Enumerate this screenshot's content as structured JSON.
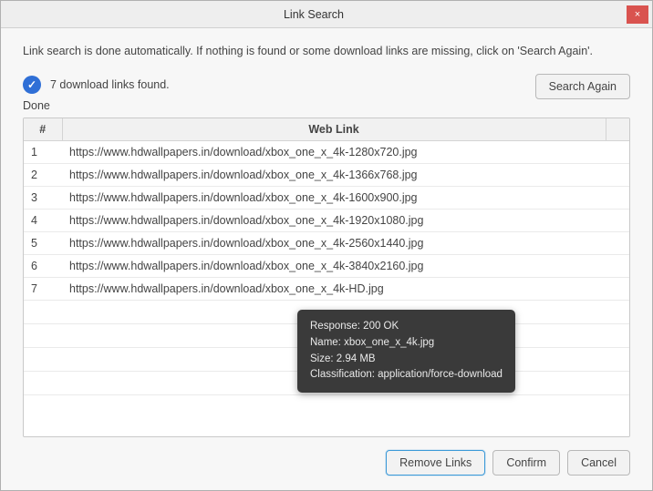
{
  "window": {
    "title": "Link Search"
  },
  "intro": "Link search is done automatically. If nothing is found or some download links are missing, click on 'Search Again'.",
  "status": {
    "found_text": "7 download links found.",
    "done_label": "Done"
  },
  "buttons": {
    "search_again": "Search Again",
    "remove_links": "Remove Links",
    "confirm": "Confirm",
    "cancel": "Cancel",
    "close": "×"
  },
  "table": {
    "headers": {
      "num": "#",
      "link": "Web Link"
    },
    "rows": [
      {
        "num": "1",
        "link": "https://www.hdwallpapers.in/download/xbox_one_x_4k-1280x720.jpg"
      },
      {
        "num": "2",
        "link": "https://www.hdwallpapers.in/download/xbox_one_x_4k-1366x768.jpg"
      },
      {
        "num": "3",
        "link": "https://www.hdwallpapers.in/download/xbox_one_x_4k-1600x900.jpg"
      },
      {
        "num": "4",
        "link": "https://www.hdwallpapers.in/download/xbox_one_x_4k-1920x1080.jpg"
      },
      {
        "num": "5",
        "link": "https://www.hdwallpapers.in/download/xbox_one_x_4k-2560x1440.jpg"
      },
      {
        "num": "6",
        "link": "https://www.hdwallpapers.in/download/xbox_one_x_4k-3840x2160.jpg"
      },
      {
        "num": "7",
        "link": "https://www.hdwallpapers.in/download/xbox_one_x_4k-HD.jpg"
      }
    ]
  },
  "tooltip": {
    "response": "Response: 200 OK",
    "name": "Name: xbox_one_x_4k.jpg",
    "size": "Size: 2.94 MB",
    "classification": "Classification: application/force-download"
  }
}
